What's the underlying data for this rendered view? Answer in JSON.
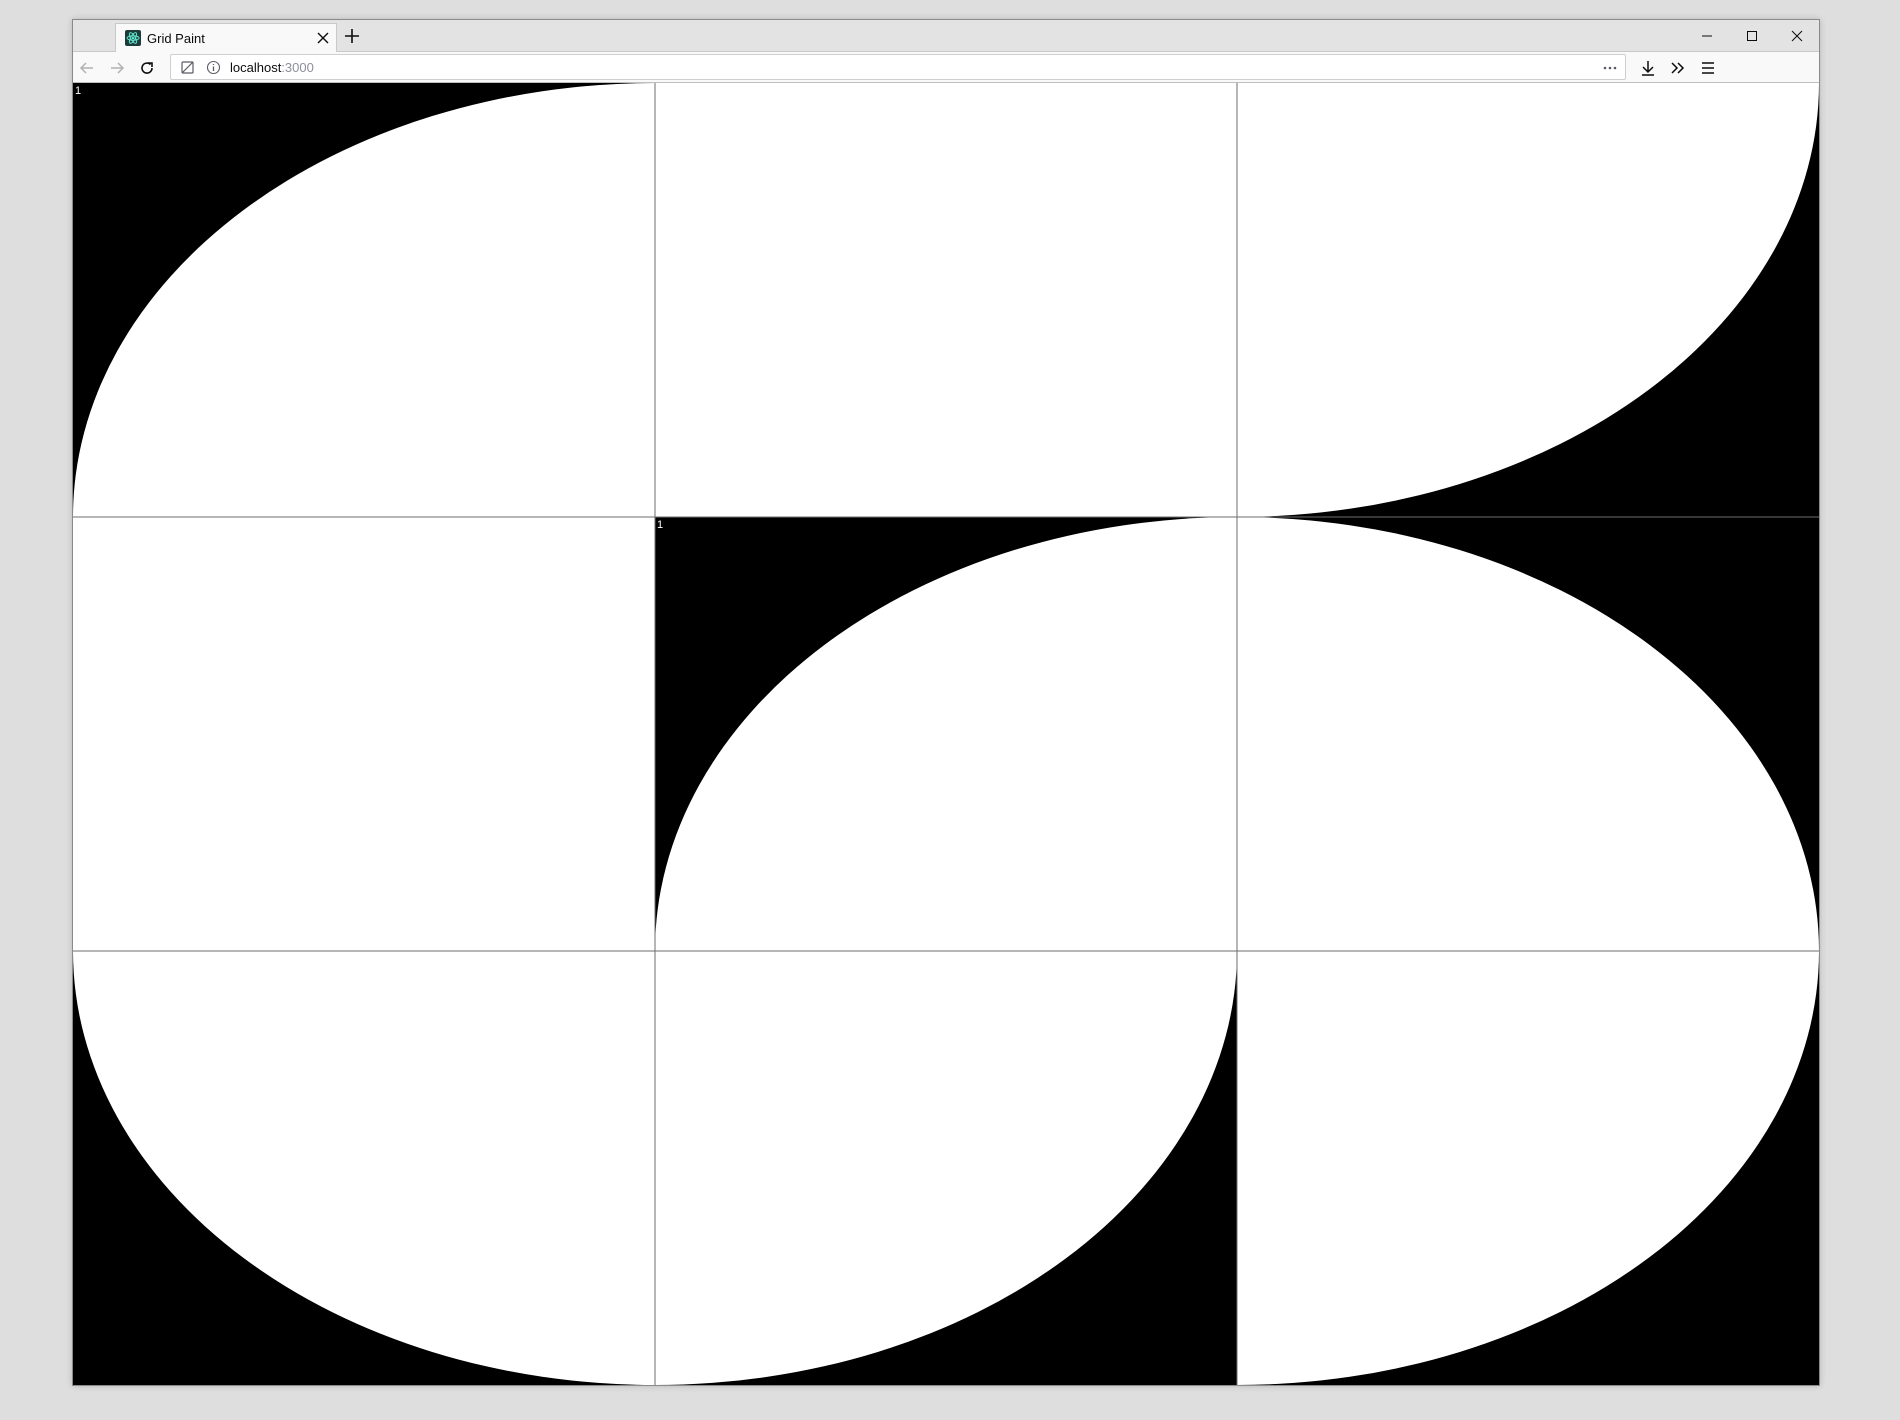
{
  "browser": {
    "tab": {
      "title": "Grid Paint"
    },
    "url": {
      "host": "localhost",
      "port": ":3000"
    }
  },
  "grid": {
    "rows": 3,
    "columns": 3,
    "cells": [
      {
        "row": 0,
        "col": 0,
        "arc_corner": "bottom-right",
        "label": "1"
      },
      {
        "row": 0,
        "col": 1,
        "arc_corner": "none",
        "label": ""
      },
      {
        "row": 0,
        "col": 2,
        "arc_corner": "top-left",
        "label": ""
      },
      {
        "row": 1,
        "col": 0,
        "arc_corner": "none",
        "label": ""
      },
      {
        "row": 1,
        "col": 1,
        "arc_corner": "bottom-right",
        "label": "1"
      },
      {
        "row": 1,
        "col": 2,
        "arc_corner": "bottom-left",
        "label": ""
      },
      {
        "row": 2,
        "col": 0,
        "arc_corner": "top-right",
        "label": ""
      },
      {
        "row": 2,
        "col": 1,
        "arc_corner": "top-left",
        "label": ""
      },
      {
        "row": 2,
        "col": 2,
        "arc_corner": "top-left",
        "label": ""
      }
    ],
    "colors": {
      "fill": "#000000",
      "shape": "#ffffff",
      "line": "#6e6e6e",
      "label": "#ffffff"
    }
  }
}
